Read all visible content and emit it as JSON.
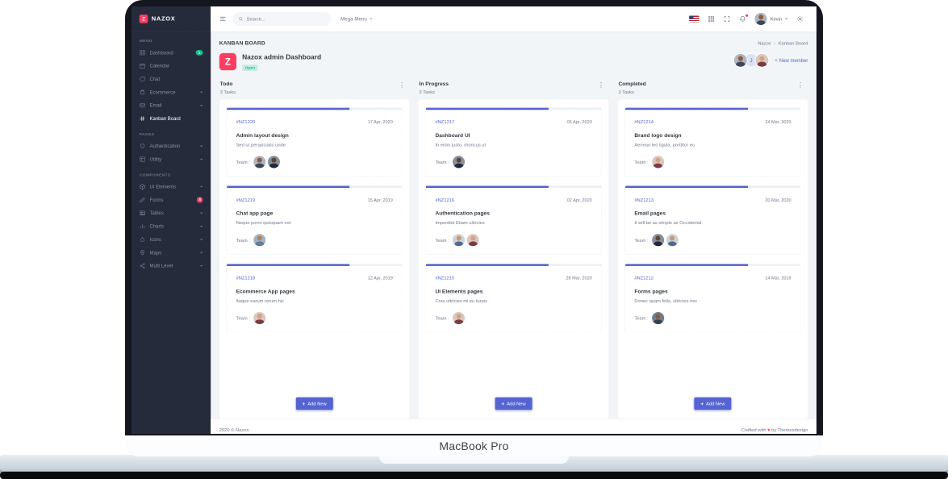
{
  "device": {
    "label": "MacBook Pro"
  },
  "ui": {
    "plus": "+",
    "dots_vertical": "⋮",
    "breadcrumb_separator": "›"
  },
  "colors": {
    "primary": "#5664d2",
    "danger": "#ff3d60",
    "success": "#1cbb8c",
    "sidebar": "#252b3b"
  },
  "sidebar": {
    "logo_glyph": "Z",
    "logo_text": "NAZOX",
    "menu_label": "MENU",
    "pages_label": "PAGES",
    "components_label": "COMPONENTS",
    "items": [
      {
        "label": "Dashboard",
        "badge": "1"
      },
      {
        "label": "Calendar"
      },
      {
        "label": "Chat"
      },
      {
        "label": "Ecommerce"
      },
      {
        "label": "Email"
      },
      {
        "label": "Kanban Board"
      },
      {
        "label": "Authentication"
      },
      {
        "label": "Utility"
      },
      {
        "label": "UI Elements"
      },
      {
        "label": "Forms",
        "badge": "8"
      },
      {
        "label": "Tables"
      },
      {
        "label": "Charts"
      },
      {
        "label": "Icons"
      },
      {
        "label": "Maps"
      },
      {
        "label": "Multi Level"
      }
    ]
  },
  "topbar": {
    "search_placeholder": "Search...",
    "mega_menu_label": "Mega Menu",
    "user_name": "Kevin"
  },
  "page": {
    "title": "KANBAN BOARD",
    "breadcrumb": [
      "Nazox",
      "Kanban Board"
    ],
    "board": {
      "logo_glyph": "Z",
      "title": "Nazox admin Dashboard",
      "status": "Open",
      "member_initial": "J",
      "new_member_label": "New member"
    }
  },
  "cards_team_label": "Team :",
  "columns": [
    {
      "name": "Todo",
      "count": "3 Tasks",
      "add_label": "Add New",
      "cards": [
        {
          "id": "#NZ1220",
          "date": "17 Apr, 2020",
          "title": "Admin layout design",
          "desc": "Sed ut perspiciatis unde",
          "progress": 70
        },
        {
          "id": "#NZ1219",
          "date": "15 Apr, 2019",
          "title": "Chat app page",
          "desc": "Neque porro quisquam est",
          "progress": 70
        },
        {
          "id": "#NZ1218",
          "date": "12 Apr, 2019",
          "title": "Ecommerce App pages",
          "desc": "Itaque earum rerum hic",
          "progress": 70
        }
      ]
    },
    {
      "name": "In Progress",
      "count": "3 Tasks",
      "add_label": "Add New",
      "cards": [
        {
          "id": "#NZ1217",
          "date": "05 Apr, 2020",
          "title": "Dashboard UI",
          "desc": "In enim justo, rhoncus ut",
          "progress": 70
        },
        {
          "id": "#NZ1216",
          "date": "02 Apr, 2020",
          "title": "Authentication pages",
          "desc": "Imperdiet Etiam ultricies",
          "progress": 70
        },
        {
          "id": "#NZ1215",
          "date": "28 Mar, 2020",
          "title": "UI Elements pages",
          "desc": "Cras ultricies mi eu turpis",
          "progress": 70
        }
      ]
    },
    {
      "name": "Completed",
      "count": "3 Tasks",
      "add_label": "Add New",
      "cards": [
        {
          "id": "#NZ1214",
          "date": "24 Mar, 2020",
          "title": "Brand logo design",
          "desc": "Aenean leo ligula, porttitor eu",
          "progress": 70
        },
        {
          "id": "#NZ1213",
          "date": "20 Mar, 2020",
          "title": "Email pages",
          "desc": "It will be as simple as Occidental.",
          "progress": 70
        },
        {
          "id": "#NZ1212",
          "date": "14 Mar, 2019",
          "title": "Forms pages",
          "desc": "Donec quam felis, ultricies nec",
          "progress": 70
        }
      ]
    }
  ],
  "footer": {
    "left": "2020 © Nazox.",
    "right_prefix": "Crafted with",
    "heart": "♥",
    "right_suffix": "by Themesdesign"
  }
}
